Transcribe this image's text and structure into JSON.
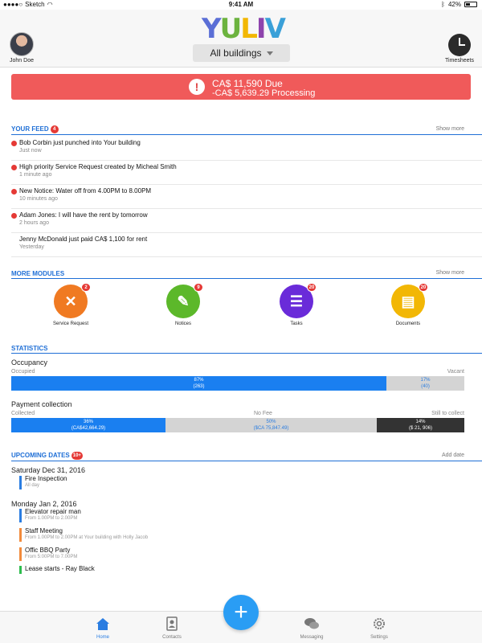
{
  "status_bar": {
    "carrier": "Sketch",
    "time": "9:41 AM",
    "battery": "42%"
  },
  "header": {
    "user_name": "John Doe",
    "logo": {
      "y": "Y",
      "u": "U",
      "l": "L",
      "i": "I",
      "v": "V"
    },
    "building_select": "All buildings",
    "timesheets_label": "Timesheets"
  },
  "due": {
    "icon": "!",
    "amount": "CA$ 11,590 Due",
    "processing": "-CA$ 5,639.29 Processing",
    "color": "#f05a5a"
  },
  "feed": {
    "title": "YOUR FEED",
    "badge": "4",
    "show_more": "Show more",
    "items": [
      {
        "text": "Bob Corbin just punched into Your building",
        "time": "Just now",
        "unread": true
      },
      {
        "text": "High priority Service Request created by Micheal Smith",
        "time": "1 minute ago",
        "unread": true
      },
      {
        "text": "New Notice: Water off from 4.00PM to 8.00PM",
        "time": "10 minutes ago",
        "unread": true
      },
      {
        "text": "Adam Jones: I will have the rent by tomorrow",
        "time": "2 hours ago",
        "unread": true
      },
      {
        "text": "Jenny McDonald just paid CA$ 1,100 for rent",
        "time": "Yesterday",
        "unread": false
      }
    ]
  },
  "modules": {
    "title": "MORE MODULES",
    "show_more": "Show more",
    "items": [
      {
        "label": "Service Request",
        "badge": "2",
        "icon": "tools-icon",
        "color": "#f07a22"
      },
      {
        "label": "Notices",
        "badge": "9",
        "icon": "notice-icon",
        "color": "#5cb82a"
      },
      {
        "label": "Tasks",
        "badge": "20",
        "icon": "tasks-icon",
        "color": "#6a2bd9"
      },
      {
        "label": "Documents",
        "badge": "20",
        "icon": "documents-icon",
        "color": "#f2b705"
      }
    ]
  },
  "statistics": {
    "title": "STATISTICS",
    "occupancy": {
      "title": "Occupancy",
      "left_label": "Occupied",
      "right_label": "Vacant",
      "occupied": {
        "pct": "87%",
        "count": "(263)",
        "fraction": 0.87
      },
      "vacant": {
        "pct": "17%",
        "count": "(40)"
      }
    },
    "payment": {
      "title": "Payment collection",
      "collected_label": "Collected",
      "nofee_label": "No Fee",
      "still_label": "Still to collect",
      "collected": {
        "pct": "36%",
        "amount": "(CA$42,664.29)"
      },
      "nofee": {
        "pct": "50%",
        "amount": "($CA 75,847.49)"
      },
      "still": {
        "pct": "14%",
        "amount": "($ 21, 906)"
      }
    }
  },
  "upcoming": {
    "title": "UPCOMING DATES",
    "badge": "10+",
    "add_date": "Add date",
    "day1": {
      "date": "Saturday Dec 31, 2016",
      "events": [
        {
          "title": "Fire Inspection",
          "sub": "All day",
          "color": "#2a7de1"
        }
      ]
    },
    "day2": {
      "date": "Monday Jan 2, 2016",
      "events": [
        {
          "title": "Elevator repair man",
          "sub": "From 1.00PM to 2.00PM",
          "color": "#2a7de1"
        },
        {
          "title": "Staff Meeting",
          "sub": "From 1.00PM to 2.00PM at Your building with Holly Jacob",
          "color": "#f28b3c"
        },
        {
          "title": "Offic BBQ Party",
          "sub": "From 5:00PM to 7.00PM",
          "color": "#f28b3c"
        },
        {
          "title": "Lease starts - Ray Black",
          "sub": "",
          "color": "#2ebd4e"
        }
      ]
    }
  },
  "tabbar": {
    "home": "Home",
    "contacts": "Contacts",
    "fab": "+",
    "messaging": "Messaging",
    "settings": "Settings"
  }
}
